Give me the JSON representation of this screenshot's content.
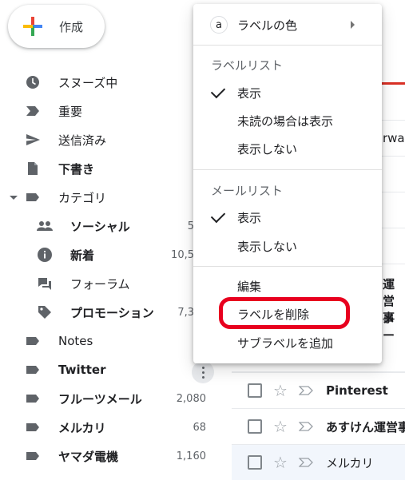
{
  "compose": {
    "label": "作成"
  },
  "nav": [
    {
      "name": "snoozed",
      "label": "スヌーズ中",
      "icon": "clock-icon",
      "bold": false,
      "count": ""
    },
    {
      "name": "important",
      "label": "重要",
      "icon": "label-important-icon",
      "bold": false,
      "count": ""
    },
    {
      "name": "sent",
      "label": "送信済み",
      "icon": "send-icon",
      "bold": false,
      "count": ""
    },
    {
      "name": "drafts",
      "label": "下書き",
      "icon": "draft-icon",
      "bold": true,
      "count": ""
    },
    {
      "name": "categories",
      "label": "カテゴリ",
      "icon": "label-icon",
      "bold": false,
      "count": ""
    },
    {
      "name": "social",
      "label": "ソーシャル",
      "icon": "people-icon",
      "bold": true,
      "count": "5"
    },
    {
      "name": "updates",
      "label": "新着",
      "icon": "info-icon",
      "bold": true,
      "count": "10,5"
    },
    {
      "name": "forums",
      "label": "フォーラム",
      "icon": "forum-icon",
      "bold": false,
      "count": ""
    },
    {
      "name": "promotions",
      "label": "プロモーション",
      "icon": "tag-icon",
      "bold": true,
      "count": "7,3"
    },
    {
      "name": "notes",
      "label": "Notes",
      "icon": "label-icon",
      "bold": false,
      "count": ""
    },
    {
      "name": "twitter",
      "label": "Twitter",
      "icon": "label-icon",
      "bold": true,
      "count": ""
    },
    {
      "name": "fruits-mail",
      "label": "フルーツメール",
      "icon": "label-icon",
      "bold": true,
      "count": "2,080"
    },
    {
      "name": "mercari",
      "label": "メルカリ",
      "icon": "label-icon",
      "bold": true,
      "count": "68"
    },
    {
      "name": "yamada",
      "label": "ヤマダ電機",
      "icon": "label-icon",
      "bold": true,
      "count": "1,160"
    }
  ],
  "behind": {
    "frag1": "rwar",
    "frag2": "運営事",
    "frag3": "メー"
  },
  "mail_rows": [
    {
      "sender": "Pinterest",
      "bold": true
    },
    {
      "sender": "あすけん運営事",
      "bold": true
    },
    {
      "sender": "メルカリ",
      "bold": false
    }
  ],
  "menu": {
    "label_color": "ラベルの色",
    "label_color_icon_letter": "a",
    "label_list_header": "ラベルリスト",
    "label_list_show": "表示",
    "label_list_show_unread": "未読の場合は表示",
    "label_list_hide": "表示しない",
    "mail_list_header": "メールリスト",
    "mail_list_show": "表示",
    "mail_list_hide": "表示しない",
    "edit": "編集",
    "delete_label": "ラベルを削除",
    "add_sublabel": "サブラベルを追加"
  },
  "colors": {
    "highlight": "#e8001e",
    "accent_red": "#d93025"
  }
}
